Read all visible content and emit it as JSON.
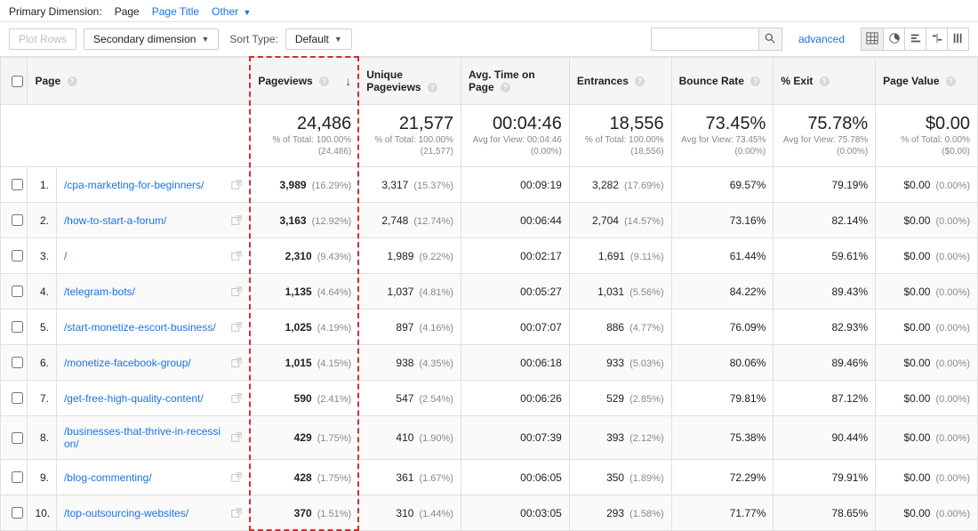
{
  "topbar": {
    "label": "Primary Dimension:",
    "dims": [
      "Page",
      "Page Title",
      "Other"
    ]
  },
  "controls": {
    "plot_rows": "Plot Rows",
    "secondary_dim": "Secondary dimension",
    "sort_type_label": "Sort Type:",
    "sort_default": "Default",
    "advanced": "advanced"
  },
  "headers": {
    "page": "Page",
    "pageviews": "Pageviews",
    "unique": "Unique Pageviews",
    "avg_time": "Avg. Time on Page",
    "entrances": "Entrances",
    "bounce": "Bounce Rate",
    "exit": "% Exit",
    "value": "Page Value"
  },
  "summary": {
    "pageviews": {
      "big": "24,486",
      "sub1": "% of Total: 100.00%",
      "sub2": "(24,486)"
    },
    "unique": {
      "big": "21,577",
      "sub1": "% of Total: 100.00%",
      "sub2": "(21,577)"
    },
    "avg_time": {
      "big": "00:04:46",
      "sub1": "Avg for View: 00:04:46",
      "sub2": "(0.00%)"
    },
    "entrances": {
      "big": "18,556",
      "sub1": "% of Total: 100.00%",
      "sub2": "(18,556)"
    },
    "bounce": {
      "big": "73.45%",
      "sub1": "Avg for View: 73.45%",
      "sub2": "(0.00%)"
    },
    "exit": {
      "big": "75.78%",
      "sub1": "Avg for View: 75.78%",
      "sub2": "(0.00%)"
    },
    "value": {
      "big": "$0.00",
      "sub1": "% of Total: 0.00%",
      "sub2": "($0.00)"
    }
  },
  "rows": [
    {
      "idx": "1.",
      "page": "/cpa-marketing-for-beginners/",
      "pv": "3,989",
      "pv_pct": "(16.29%)",
      "upv": "3,317",
      "upv_pct": "(15.37%)",
      "time": "00:09:19",
      "ent": "3,282",
      "ent_pct": "(17.69%)",
      "br": "69.57%",
      "exit": "79.19%",
      "val": "$0.00",
      "val_pct": "(0.00%)"
    },
    {
      "idx": "2.",
      "page": "/how-to-start-a-forum/",
      "pv": "3,163",
      "pv_pct": "(12.92%)",
      "upv": "2,748",
      "upv_pct": "(12.74%)",
      "time": "00:06:44",
      "ent": "2,704",
      "ent_pct": "(14.57%)",
      "br": "73.16%",
      "exit": "82.14%",
      "val": "$0.00",
      "val_pct": "(0.00%)"
    },
    {
      "idx": "3.",
      "page": "/",
      "pv": "2,310",
      "pv_pct": "(9.43%)",
      "upv": "1,989",
      "upv_pct": "(9.22%)",
      "time": "00:02:17",
      "ent": "1,691",
      "ent_pct": "(9.11%)",
      "br": "61.44%",
      "exit": "59.61%",
      "val": "$0.00",
      "val_pct": "(0.00%)"
    },
    {
      "idx": "4.",
      "page": "/telegram-bots/",
      "pv": "1,135",
      "pv_pct": "(4.64%)",
      "upv": "1,037",
      "upv_pct": "(4.81%)",
      "time": "00:05:27",
      "ent": "1,031",
      "ent_pct": "(5.56%)",
      "br": "84.22%",
      "exit": "89.43%",
      "val": "$0.00",
      "val_pct": "(0.00%)"
    },
    {
      "idx": "5.",
      "page": "/start-monetize-escort-business/",
      "pv": "1,025",
      "pv_pct": "(4.19%)",
      "upv": "897",
      "upv_pct": "(4.16%)",
      "time": "00:07:07",
      "ent": "886",
      "ent_pct": "(4.77%)",
      "br": "76.09%",
      "exit": "82.93%",
      "val": "$0.00",
      "val_pct": "(0.00%)"
    },
    {
      "idx": "6.",
      "page": "/monetize-facebook-group/",
      "pv": "1,015",
      "pv_pct": "(4.15%)",
      "upv": "938",
      "upv_pct": "(4.35%)",
      "time": "00:06:18",
      "ent": "933",
      "ent_pct": "(5.03%)",
      "br": "80.06%",
      "exit": "89.46%",
      "val": "$0.00",
      "val_pct": "(0.00%)"
    },
    {
      "idx": "7.",
      "page": "/get-free-high-quality-content/",
      "pv": "590",
      "pv_pct": "(2.41%)",
      "upv": "547",
      "upv_pct": "(2.54%)",
      "time": "00:06:26",
      "ent": "529",
      "ent_pct": "(2.85%)",
      "br": "79.81%",
      "exit": "87.12%",
      "val": "$0.00",
      "val_pct": "(0.00%)"
    },
    {
      "idx": "8.",
      "page": "/businesses-that-thrive-in-recession/",
      "pv": "429",
      "pv_pct": "(1.75%)",
      "upv": "410",
      "upv_pct": "(1.90%)",
      "time": "00:07:39",
      "ent": "393",
      "ent_pct": "(2.12%)",
      "br": "75.38%",
      "exit": "90.44%",
      "val": "$0.00",
      "val_pct": "(0.00%)"
    },
    {
      "idx": "9.",
      "page": "/blog-commenting/",
      "pv": "428",
      "pv_pct": "(1.75%)",
      "upv": "361",
      "upv_pct": "(1.67%)",
      "time": "00:06:05",
      "ent": "350",
      "ent_pct": "(1.89%)",
      "br": "72.29%",
      "exit": "79.91%",
      "val": "$0.00",
      "val_pct": "(0.00%)"
    },
    {
      "idx": "10.",
      "page": "/top-outsourcing-websites/",
      "pv": "370",
      "pv_pct": "(1.51%)",
      "upv": "310",
      "upv_pct": "(1.44%)",
      "time": "00:03:05",
      "ent": "293",
      "ent_pct": "(1.58%)",
      "br": "71.77%",
      "exit": "78.65%",
      "val": "$0.00",
      "val_pct": "(0.00%)"
    }
  ]
}
